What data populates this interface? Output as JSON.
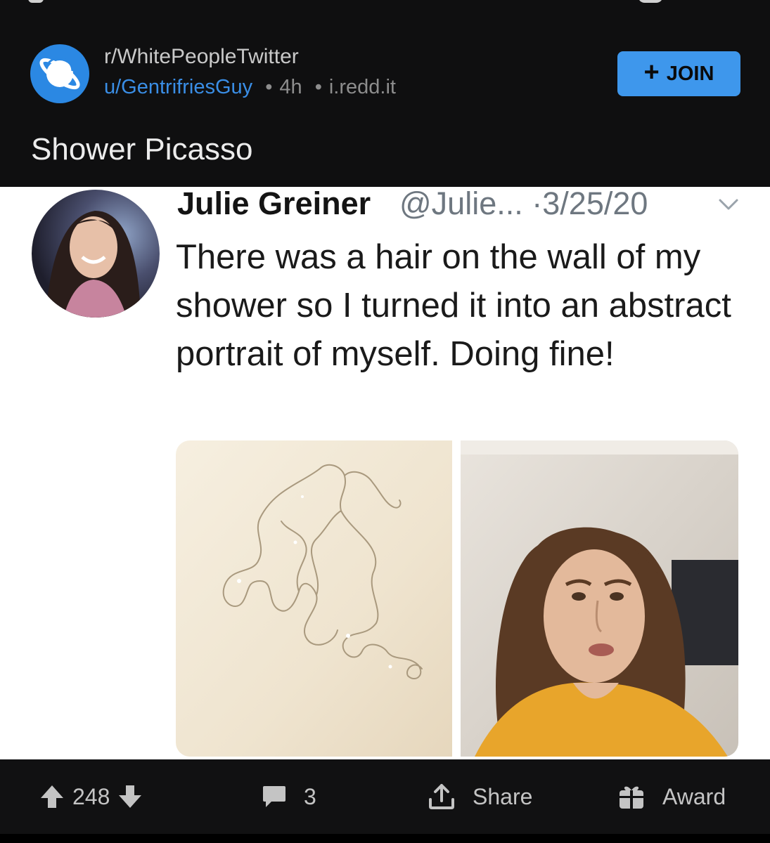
{
  "post": {
    "subreddit": "r/WhitePeopleTwitter",
    "author": "u/GentrifriesGuy",
    "separator": "•",
    "age": "4h",
    "domain": "i.redd.it",
    "join_label": "JOIN",
    "join_symbol": "+",
    "title": "Shower Picasso"
  },
  "tweet": {
    "name": "Julie Greiner",
    "handle": "@Julie...",
    "separator": "·",
    "date": "3/25/20",
    "text": "There was a hair on the wall of my shower so I turned it into an abstract portrait of myself. Doing fine!"
  },
  "actions": {
    "votes": "248",
    "comments": "3",
    "share_label": "Share",
    "award_label": "Award"
  },
  "colors": {
    "background": "#0f0f10",
    "accent": "#3e97ec",
    "link": "#3a8ee6",
    "subreddit_icon": "#2b88e3"
  },
  "icons": [
    "subreddit-planet-icon",
    "chevron-down-icon",
    "upvote-icon",
    "downvote-icon",
    "comment-icon",
    "share-icon",
    "award-gift-icon"
  ]
}
